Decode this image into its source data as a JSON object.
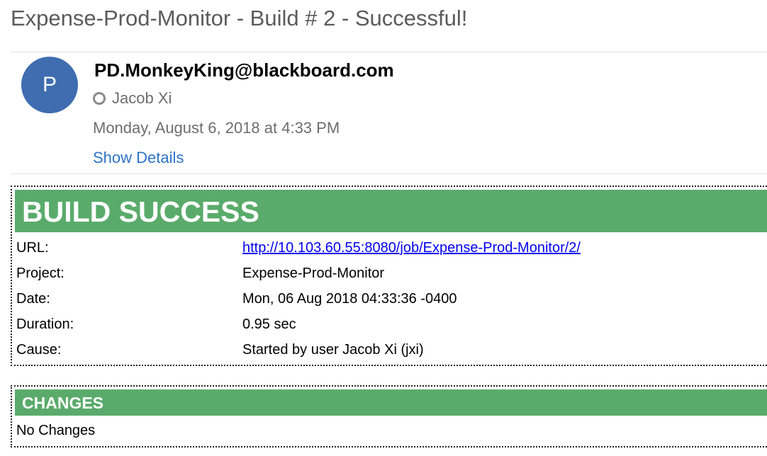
{
  "email": {
    "subject": "Expense-Prod-Monitor - Build # 2 - Successful!",
    "avatar_initial": "P",
    "sender": "PD.MonkeyKing@blackboard.com",
    "recipient": "Jacob Xi",
    "date": "Monday, August 6, 2018 at 4:33 PM",
    "show_details_label": "Show Details",
    "presence_icon": "presence-status-icon"
  },
  "build": {
    "header": "BUILD SUCCESS",
    "rows": [
      {
        "label": "URL:",
        "value": "http://10.103.60.55:8080/job/Expense-Prod-Monitor/2/"
      },
      {
        "label": "Project:",
        "value": "Expense-Prod-Monitor"
      },
      {
        "label": "Date:",
        "value": "Mon, 06 Aug 2018 04:33:36 -0400"
      },
      {
        "label": "Duration:",
        "value": "0.95 sec"
      },
      {
        "label": "Cause:",
        "value": "Started by user Jacob Xi (jxi)"
      }
    ]
  },
  "changes": {
    "header": "CHANGES",
    "text": "No Changes"
  },
  "colors": {
    "success_green": "#5aab6b",
    "avatar_blue": "#3f6db0",
    "link_blue": "#2d73c5"
  }
}
